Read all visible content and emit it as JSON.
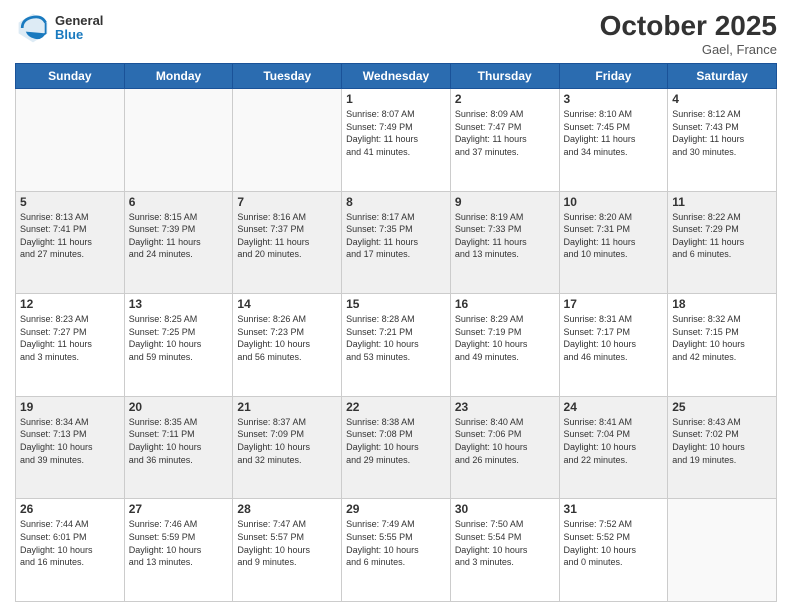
{
  "header": {
    "logo_line1": "General",
    "logo_line2": "Blue",
    "month_year": "October 2025",
    "location": "Gael, France"
  },
  "weekdays": [
    "Sunday",
    "Monday",
    "Tuesday",
    "Wednesday",
    "Thursday",
    "Friday",
    "Saturday"
  ],
  "weeks": [
    {
      "shaded": false,
      "days": [
        {
          "num": "",
          "info": ""
        },
        {
          "num": "",
          "info": ""
        },
        {
          "num": "",
          "info": ""
        },
        {
          "num": "1",
          "info": "Sunrise: 8:07 AM\nSunset: 7:49 PM\nDaylight: 11 hours\nand 41 minutes."
        },
        {
          "num": "2",
          "info": "Sunrise: 8:09 AM\nSunset: 7:47 PM\nDaylight: 11 hours\nand 37 minutes."
        },
        {
          "num": "3",
          "info": "Sunrise: 8:10 AM\nSunset: 7:45 PM\nDaylight: 11 hours\nand 34 minutes."
        },
        {
          "num": "4",
          "info": "Sunrise: 8:12 AM\nSunset: 7:43 PM\nDaylight: 11 hours\nand 30 minutes."
        }
      ]
    },
    {
      "shaded": true,
      "days": [
        {
          "num": "5",
          "info": "Sunrise: 8:13 AM\nSunset: 7:41 PM\nDaylight: 11 hours\nand 27 minutes."
        },
        {
          "num": "6",
          "info": "Sunrise: 8:15 AM\nSunset: 7:39 PM\nDaylight: 11 hours\nand 24 minutes."
        },
        {
          "num": "7",
          "info": "Sunrise: 8:16 AM\nSunset: 7:37 PM\nDaylight: 11 hours\nand 20 minutes."
        },
        {
          "num": "8",
          "info": "Sunrise: 8:17 AM\nSunset: 7:35 PM\nDaylight: 11 hours\nand 17 minutes."
        },
        {
          "num": "9",
          "info": "Sunrise: 8:19 AM\nSunset: 7:33 PM\nDaylight: 11 hours\nand 13 minutes."
        },
        {
          "num": "10",
          "info": "Sunrise: 8:20 AM\nSunset: 7:31 PM\nDaylight: 11 hours\nand 10 minutes."
        },
        {
          "num": "11",
          "info": "Sunrise: 8:22 AM\nSunset: 7:29 PM\nDaylight: 11 hours\nand 6 minutes."
        }
      ]
    },
    {
      "shaded": false,
      "days": [
        {
          "num": "12",
          "info": "Sunrise: 8:23 AM\nSunset: 7:27 PM\nDaylight: 11 hours\nand 3 minutes."
        },
        {
          "num": "13",
          "info": "Sunrise: 8:25 AM\nSunset: 7:25 PM\nDaylight: 10 hours\nand 59 minutes."
        },
        {
          "num": "14",
          "info": "Sunrise: 8:26 AM\nSunset: 7:23 PM\nDaylight: 10 hours\nand 56 minutes."
        },
        {
          "num": "15",
          "info": "Sunrise: 8:28 AM\nSunset: 7:21 PM\nDaylight: 10 hours\nand 53 minutes."
        },
        {
          "num": "16",
          "info": "Sunrise: 8:29 AM\nSunset: 7:19 PM\nDaylight: 10 hours\nand 49 minutes."
        },
        {
          "num": "17",
          "info": "Sunrise: 8:31 AM\nSunset: 7:17 PM\nDaylight: 10 hours\nand 46 minutes."
        },
        {
          "num": "18",
          "info": "Sunrise: 8:32 AM\nSunset: 7:15 PM\nDaylight: 10 hours\nand 42 minutes."
        }
      ]
    },
    {
      "shaded": true,
      "days": [
        {
          "num": "19",
          "info": "Sunrise: 8:34 AM\nSunset: 7:13 PM\nDaylight: 10 hours\nand 39 minutes."
        },
        {
          "num": "20",
          "info": "Sunrise: 8:35 AM\nSunset: 7:11 PM\nDaylight: 10 hours\nand 36 minutes."
        },
        {
          "num": "21",
          "info": "Sunrise: 8:37 AM\nSunset: 7:09 PM\nDaylight: 10 hours\nand 32 minutes."
        },
        {
          "num": "22",
          "info": "Sunrise: 8:38 AM\nSunset: 7:08 PM\nDaylight: 10 hours\nand 29 minutes."
        },
        {
          "num": "23",
          "info": "Sunrise: 8:40 AM\nSunset: 7:06 PM\nDaylight: 10 hours\nand 26 minutes."
        },
        {
          "num": "24",
          "info": "Sunrise: 8:41 AM\nSunset: 7:04 PM\nDaylight: 10 hours\nand 22 minutes."
        },
        {
          "num": "25",
          "info": "Sunrise: 8:43 AM\nSunset: 7:02 PM\nDaylight: 10 hours\nand 19 minutes."
        }
      ]
    },
    {
      "shaded": false,
      "days": [
        {
          "num": "26",
          "info": "Sunrise: 7:44 AM\nSunset: 6:01 PM\nDaylight: 10 hours\nand 16 minutes."
        },
        {
          "num": "27",
          "info": "Sunrise: 7:46 AM\nSunset: 5:59 PM\nDaylight: 10 hours\nand 13 minutes."
        },
        {
          "num": "28",
          "info": "Sunrise: 7:47 AM\nSunset: 5:57 PM\nDaylight: 10 hours\nand 9 minutes."
        },
        {
          "num": "29",
          "info": "Sunrise: 7:49 AM\nSunset: 5:55 PM\nDaylight: 10 hours\nand 6 minutes."
        },
        {
          "num": "30",
          "info": "Sunrise: 7:50 AM\nSunset: 5:54 PM\nDaylight: 10 hours\nand 3 minutes."
        },
        {
          "num": "31",
          "info": "Sunrise: 7:52 AM\nSunset: 5:52 PM\nDaylight: 10 hours\nand 0 minutes."
        },
        {
          "num": "",
          "info": ""
        }
      ]
    }
  ]
}
